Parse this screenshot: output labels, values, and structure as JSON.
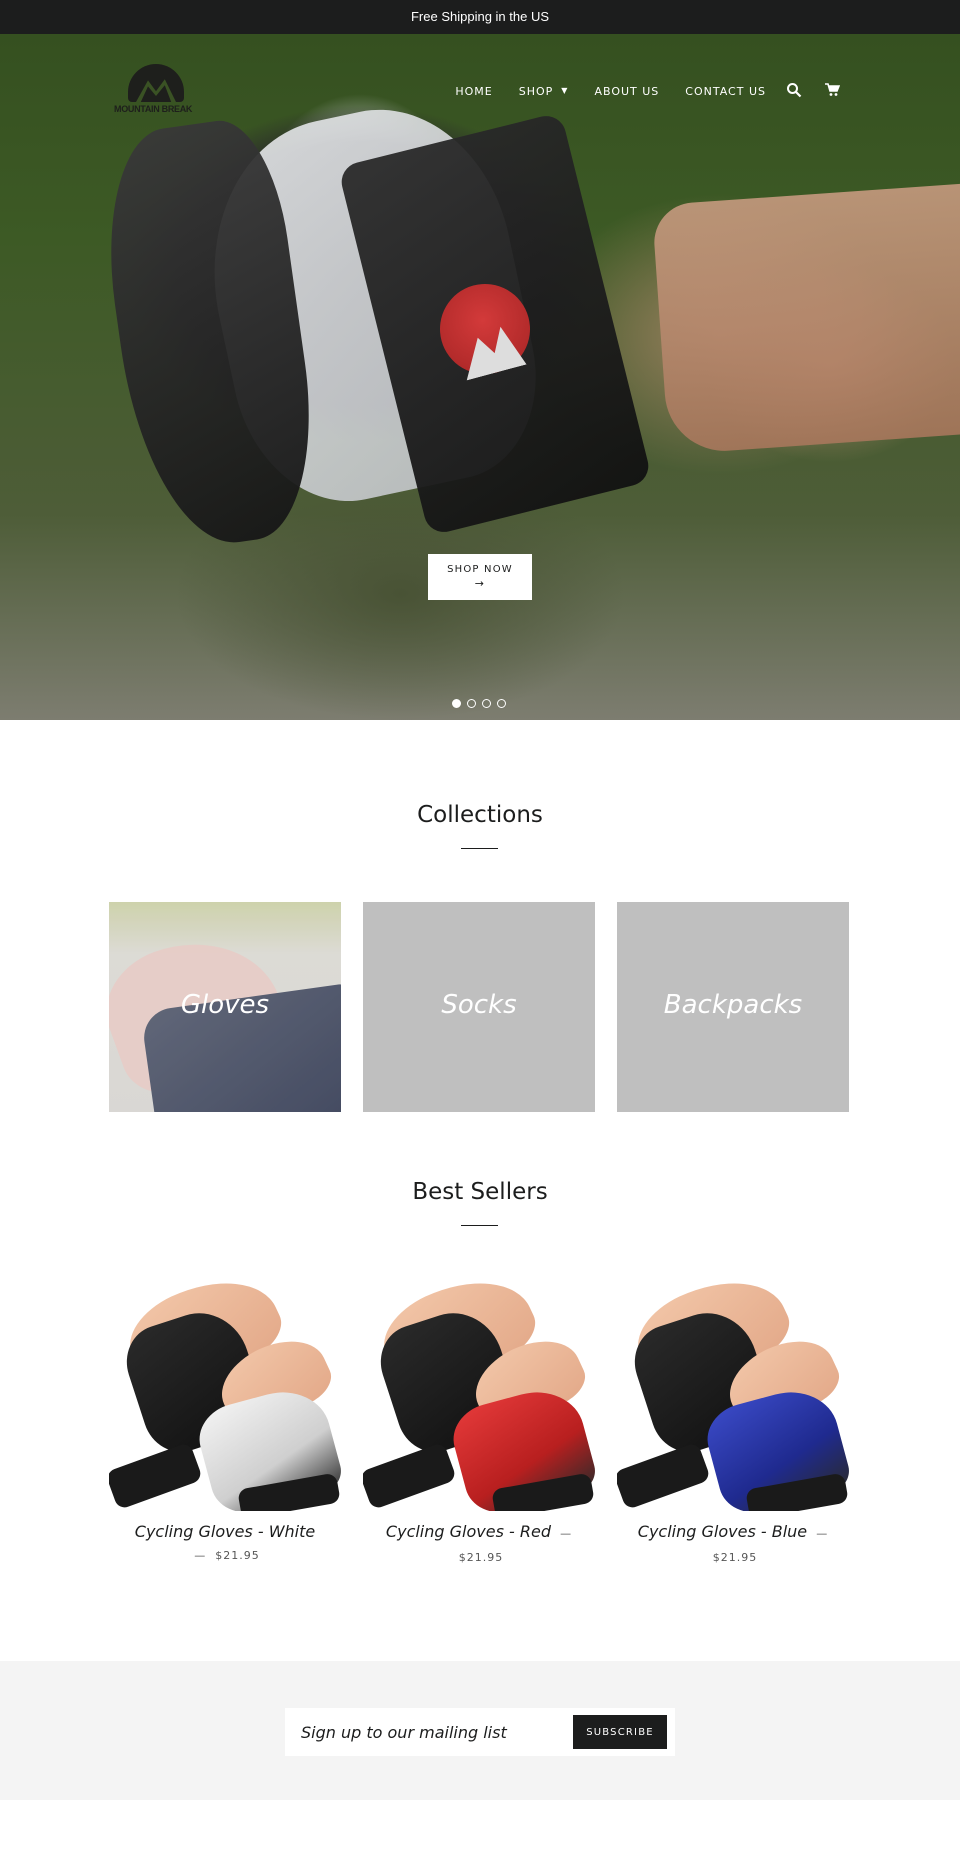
{
  "announcement": {
    "text": "Free Shipping in the US"
  },
  "header": {
    "logo_text": "MOUNTAIN BREAK",
    "nav": [
      {
        "label": "HOME"
      },
      {
        "label": "SHOP",
        "has_dropdown": true,
        "caret": "▼"
      },
      {
        "label": "ABOUT US"
      },
      {
        "label": "CONTACT US"
      }
    ],
    "icons": {
      "search": "search-icon",
      "cart": "cart-icon"
    }
  },
  "hero": {
    "cta_label": "SHOP NOW",
    "cta_arrow": "→",
    "slides_total": 4,
    "active_slide": 1
  },
  "collections": {
    "title": "Collections",
    "items": [
      {
        "label": "Gloves"
      },
      {
        "label": "Socks"
      },
      {
        "label": "Backpacks"
      }
    ]
  },
  "best_sellers": {
    "title": "Best Sellers",
    "products": [
      {
        "title": "Cycling Gloves - White",
        "separator": "—",
        "price": "$21.95",
        "accent": "#ffffff"
      },
      {
        "title": "Cycling Gloves - Red",
        "separator": "—",
        "price": "$21.95",
        "accent": "#d42a2a"
      },
      {
        "title": "Cycling Gloves - Blue",
        "separator": "—",
        "price": "$21.95",
        "accent": "#2a3aa8"
      }
    ]
  },
  "newsletter": {
    "placeholder": "Sign up to our mailing list",
    "button_label": "SUBSCRIBE"
  },
  "colors": {
    "dark": "#1c1d1d",
    "newsletter_bg": "#f4f4f4",
    "collection_placeholder": "#bfbfbf"
  }
}
